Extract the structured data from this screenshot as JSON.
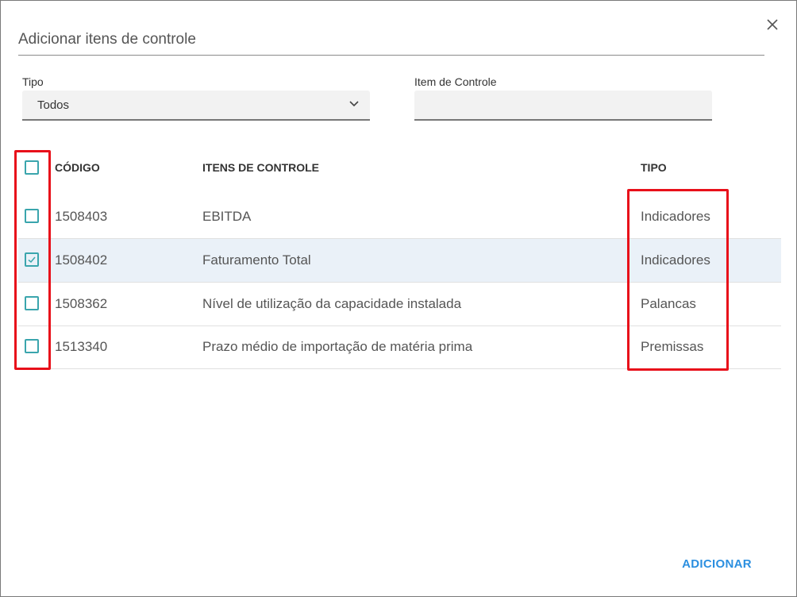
{
  "dialog": {
    "title": "Adicionar itens de controle",
    "close_icon": "close-icon"
  },
  "filters": {
    "tipo_label": "Tipo",
    "tipo_value": "Todos",
    "item_label": "Item de Controle",
    "item_value": ""
  },
  "table": {
    "headers": {
      "codigo": "CÓDIGO",
      "itens": "ITENS DE CONTROLE",
      "tipo": "TIPO"
    },
    "select_all_checked": false,
    "rows": [
      {
        "codigo": "1508403",
        "item": "EBITDA",
        "tipo": "Indicadores",
        "checked": false
      },
      {
        "codigo": "1508402",
        "item": "Faturamento Total",
        "tipo": "Indicadores",
        "checked": true
      },
      {
        "codigo": "1508362",
        "item": "Nível de utilização da capacidade instalada",
        "tipo": "Palancas",
        "checked": false
      },
      {
        "codigo": "1513340",
        "item": "Prazo médio de importação de matéria prima",
        "tipo": "Premissas",
        "checked": false
      }
    ]
  },
  "actions": {
    "add_label": "ADICIONAR"
  },
  "colors": {
    "accent": "#2b8fe0",
    "checkbox": "#3aa5ad",
    "highlight": "#e8101a",
    "selected_row": "#eaf1f8"
  }
}
